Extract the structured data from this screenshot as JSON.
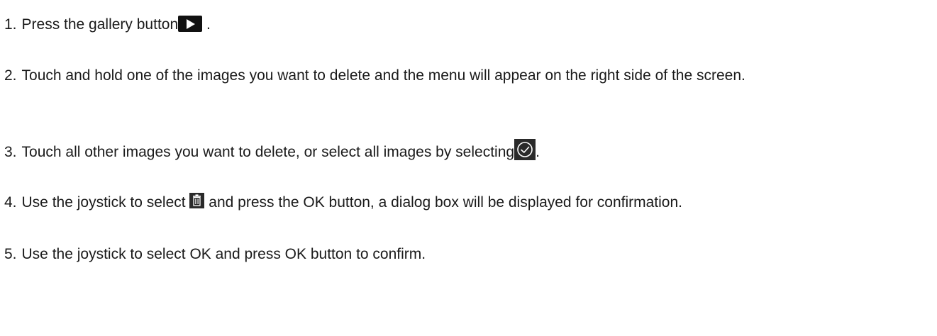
{
  "steps": [
    {
      "number": "1.",
      "text_before": "Press the gallery button",
      "icon": "gallery-play-icon",
      "text_after": " ."
    },
    {
      "number": "2.",
      "text": "Touch and hold one of the images you want to delete and the menu will appear on the right side of the screen."
    },
    {
      "number": "3.",
      "text_before": "Touch all other images you want to delete, or select all images by selecting",
      "icon": "select-all-check-icon",
      "text_after": "."
    },
    {
      "number": "4.",
      "text_before": "Use the joystick to select ",
      "icon": "trash-icon",
      "text_after": " and press the OK button, a dialog box will be displayed for confirmation."
    },
    {
      "number": "5.",
      "text": "Use the joystick to select OK and press OK button to confirm."
    }
  ]
}
